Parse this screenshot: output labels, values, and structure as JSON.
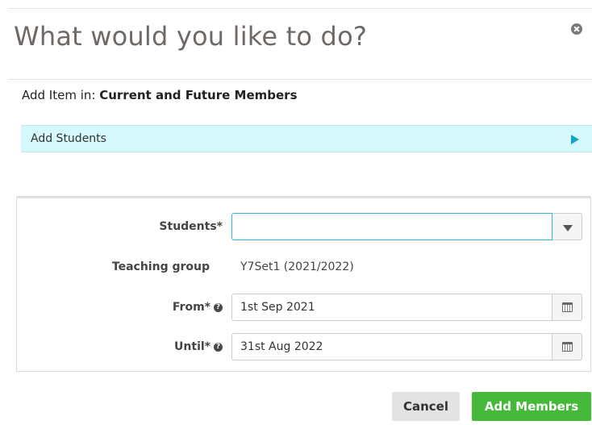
{
  "dialog": {
    "title": "What would you like to do?",
    "close_icon": "close-circle-icon"
  },
  "add_item": {
    "prefix": "Add Item in: ",
    "target": "Current and Future Members"
  },
  "action": {
    "label": "Add Students",
    "icon": "play-arrow-icon",
    "accent": "#1aa3c2",
    "background": "#d4f8fb"
  },
  "form": {
    "students": {
      "label": "Students*",
      "value": "",
      "placeholder": ""
    },
    "teaching_group": {
      "label": "Teaching group",
      "value": "Y7Set1 (2021/2022)"
    },
    "from": {
      "label": "From*",
      "value": "1st Sep 2021"
    },
    "until": {
      "label": "Until*",
      "value": "31st Aug 2022"
    },
    "help_glyph": "?"
  },
  "buttons": {
    "cancel": "Cancel",
    "add": "Add Members",
    "add_color": "#46b93b"
  }
}
